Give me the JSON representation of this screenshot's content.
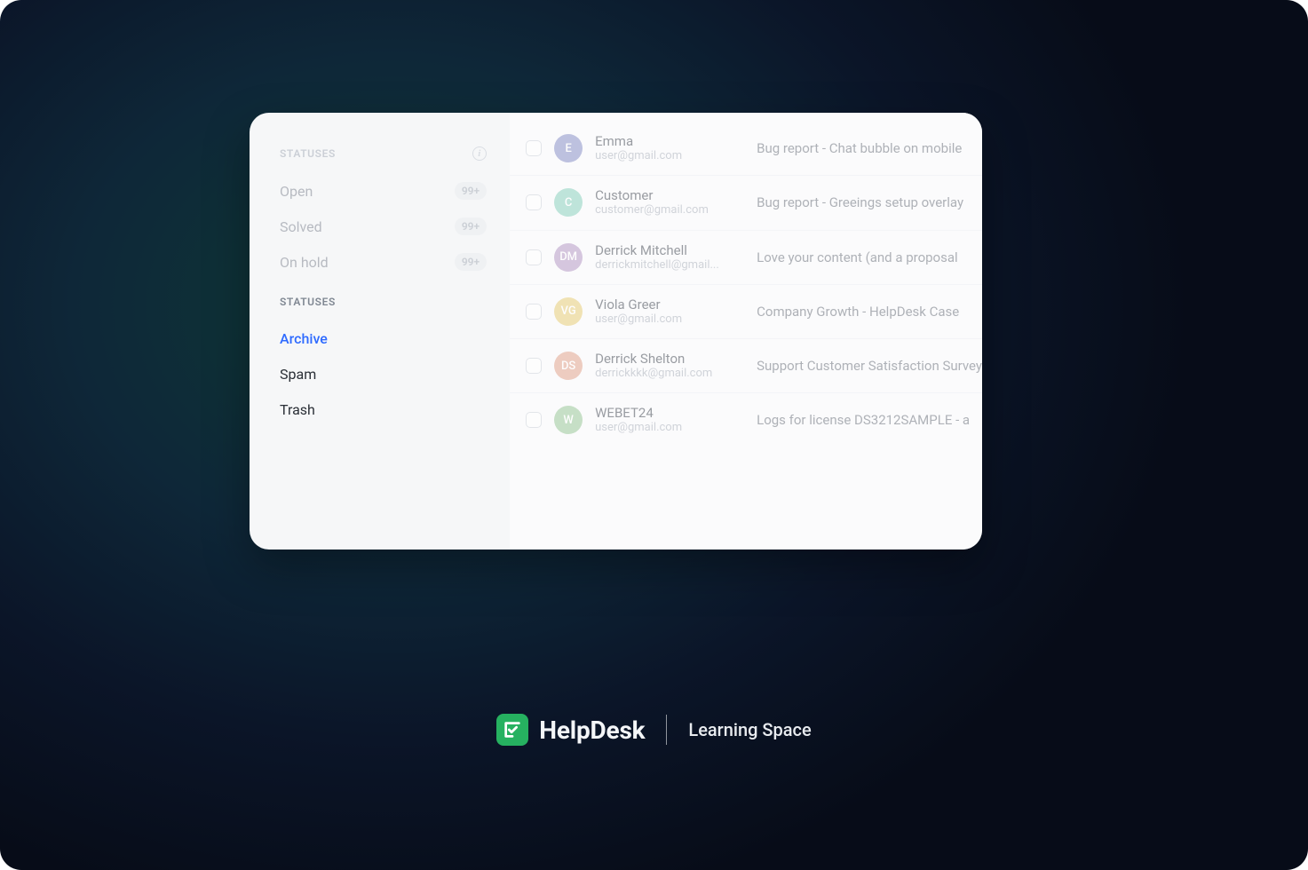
{
  "sidebar": {
    "section1": {
      "label": "STATUSES",
      "items": [
        {
          "label": "Open",
          "badge": "99+"
        },
        {
          "label": "Solved",
          "badge": "99+"
        },
        {
          "label": "On hold",
          "badge": "99+"
        }
      ]
    },
    "section2": {
      "label": "STATUSES",
      "items": [
        {
          "label": "Archive"
        },
        {
          "label": "Spam"
        },
        {
          "label": "Trash"
        }
      ]
    }
  },
  "tickets": [
    {
      "avatar": {
        "initials": "E",
        "color": "#8b93c9"
      },
      "name": "Emma",
      "email": "user@gmail.com",
      "subject": "Bug report - Chat bubble on mobile"
    },
    {
      "avatar": {
        "initials": "C",
        "color": "#8dd3bf"
      },
      "name": "Customer",
      "email": "customer@gmail.com",
      "subject": "Bug report - Greeings setup overlay"
    },
    {
      "avatar": {
        "initials": "DM",
        "color": "#b79cc7"
      },
      "name": "Derrick Mitchell",
      "email": "derrickmitchell@gmail...",
      "subject": "Love your content (and a proposal"
    },
    {
      "avatar": {
        "initials": "VG",
        "color": "#e8cf7a"
      },
      "name": "Viola Greer",
      "email": "user@gmail.com",
      "subject": "Company Growth - HelpDesk Case"
    },
    {
      "avatar": {
        "initials": "DS",
        "color": "#e2a690"
      },
      "name": "Derrick Shelton",
      "email": "derrickkkk@gmail.com",
      "subject": "Support Customer Satisfaction Survey"
    },
    {
      "avatar": {
        "initials": "W",
        "color": "#9cc99a"
      },
      "name": "WEBET24",
      "email": "user@gmail.com",
      "subject": "Logs for license DS3212SAMPLE - a"
    }
  ],
  "footer": {
    "brand": "HelpDesk",
    "tagline": "Learning Space"
  }
}
